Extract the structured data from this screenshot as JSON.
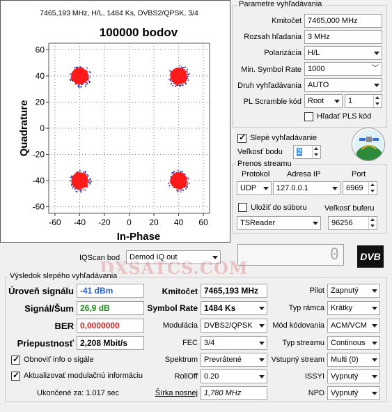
{
  "plot": {
    "header": "7465,193 MHz, H/L, 1484 Ks, DVBS2/QPSK, 3/4",
    "title": "100000 bodov",
    "xlabel": "In-Phase",
    "ylabel": "Quadrature",
    "xticks": [
      "-60",
      "-40",
      "-20",
      "0",
      "20",
      "40",
      "60"
    ],
    "yticks": [
      "60",
      "40",
      "20",
      "0",
      "-20",
      "-40",
      "-60"
    ]
  },
  "chart_data": {
    "type": "scatter",
    "title": "100000 bodov",
    "xlabel": "In-Phase",
    "ylabel": "Quadrature",
    "xlim": [
      -65,
      65
    ],
    "ylim": [
      -65,
      65
    ],
    "grid": true,
    "points_description": "QPSK constellation clusters",
    "clusters": [
      {
        "x": -40,
        "y": 40
      },
      {
        "x": 40,
        "y": 40
      },
      {
        "x": -40,
        "y": -40
      },
      {
        "x": 40,
        "y": -40
      }
    ],
    "colors": {
      "core": "#ff1a1a",
      "edge": "#1a1aa0"
    }
  },
  "params": {
    "group_label": "Parametre vyhľadávania",
    "freq_label": "Kmitočet",
    "freq_value": "7465,000 MHz",
    "range_label": "Rozsah hľadania",
    "range_value": "3 MHz",
    "pol_label": "Polarizácia",
    "pol_value": "H/L",
    "msr_label": "Min. Symbol Rate",
    "msr_value": "1000",
    "type_label": "Druh vyhľadávania",
    "type_value": "AUTO",
    "pls_label": "PL Scramble kód",
    "pls_mode": "Root",
    "pls_value": "1",
    "pls_search_label": "Hľadať PLS kód"
  },
  "blind": {
    "blind_label": "Slepé vyhľadávanie",
    "step_label": "Veľkosť bodu",
    "step_value": "2"
  },
  "stream": {
    "group_label": "Prenos streamu",
    "proto_label": "Protokol",
    "ip_label": "Adresa IP",
    "port_label": "Port",
    "proto_value": "UDP",
    "ip_value": "127.0.0.1",
    "port_value": "6969",
    "save_label": "Uložiť do súboru",
    "buf_label": "Veľkosť buferu",
    "app_value": "TSReader",
    "buf_value": "96256"
  },
  "iq": {
    "label": "IQScan bod",
    "value": "Demod IQ out",
    "counter": "0",
    "logo": "DVB"
  },
  "results": {
    "group_label": "Výsledok slepého vyhľadávania",
    "level_label": "Úroveň signálu",
    "level_value": "-41 dBm",
    "snr_label": "Signál/Šum",
    "snr_value": "26,9 dB",
    "ber_label": "BER",
    "ber_value": "0,0000000",
    "thr_label": "Priepustnosť",
    "thr_value": "2,208 Mbit/s",
    "refresh_label": "Obnoviť info o sigále",
    "update_label": "Aktualizovať modulačnú informáciu",
    "done_label": "Ukončené za: 1.017 sec",
    "freq_label": "Kmitočet",
    "freq_value": "7465,193 MHz",
    "sr_label": "Symbol Rate",
    "sr_value": "1484 Ks",
    "mod_label": "Modulácia",
    "mod_value": "DVBS2/QPSK",
    "fec_label": "FEC",
    "fec_value": "3/4",
    "spec_label": "Spektrum",
    "spec_value": "Prevrátené",
    "roll_label": "RollOff",
    "roll_value": "0.20",
    "bw_label": "Šírka nosnej",
    "bw_value": "1,780 MHz",
    "pilot_label": "Pilot",
    "pilot_value": "Zapnutý",
    "frame_label": "Typ rámca",
    "frame_value": "Krátky",
    "modcod_label": "Mód kódovania",
    "modcod_value": "ACM/VCM",
    "stype_label": "Typ streamu",
    "stype_value": "Continous",
    "istream_label": "Vstupný stream",
    "istream_value": "Multi (0)",
    "issyi_label": "ISSYI",
    "issyi_value": "Vypnutý",
    "npd_label": "NPD",
    "npd_value": "Vypnutý"
  },
  "watermark": "DXSATCS.COM"
}
